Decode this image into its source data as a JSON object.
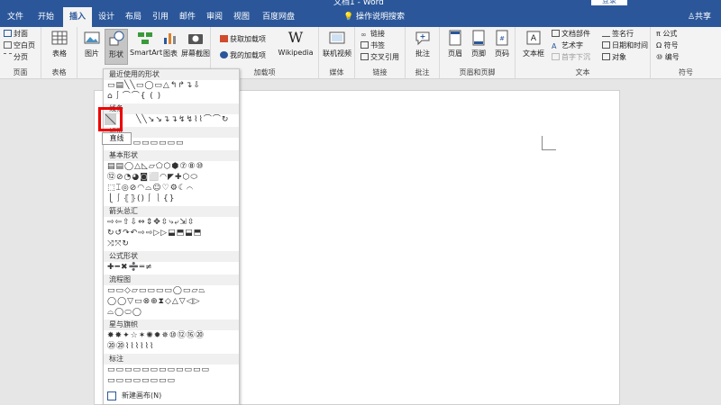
{
  "app": {
    "title": "文档1 - Word",
    "login": "登录",
    "share": "共享",
    "help_search": "操作说明搜索"
  },
  "tabs": [
    "文件",
    "开始",
    "插入",
    "设计",
    "布局",
    "引用",
    "邮件",
    "审阅",
    "视图",
    "百度网盘"
  ],
  "ribbon": {
    "page": {
      "cover": "封面",
      "blank": "空白页",
      "break": "分页",
      "label": "页面"
    },
    "table": {
      "label": "表格",
      "btn": "表格"
    },
    "illust": {
      "picture": "图片",
      "shapes": "形状",
      "smartart": "SmartArt",
      "chart": "图表",
      "screenshot": "屏幕截图"
    },
    "addins": {
      "get": "获取加载项",
      "mine": "我的加载项",
      "wikipedia": "Wikipedia",
      "label": "加载项"
    },
    "media": {
      "video": "联机视频",
      "label": "媒体"
    },
    "links": {
      "link": "链接",
      "bookmark": "书签",
      "crossref": "交叉引用",
      "label": "链接"
    },
    "comments": {
      "comment": "批注",
      "label": "批注"
    },
    "hf": {
      "header": "页眉",
      "footer": "页脚",
      "pagenum": "页码",
      "label": "页眉和页脚"
    },
    "text": {
      "textbox": "文本框",
      "parts": "文档部件",
      "wordart": "艺术字",
      "dropcap": "首字下沉",
      "sigline": "签名行",
      "datetime": "日期和时间",
      "object": "对象",
      "label": "文本"
    },
    "symbols": {
      "equation": "公式",
      "symbol": "符号",
      "number": "编号",
      "label": "符号"
    }
  },
  "gallery": {
    "sections": [
      {
        "title": "最近使用的形状",
        "rows": [
          "▭▤╲╲▭◯▭△↰↱↴⇩",
          "⌂⎰⌒⌒{ ( )"
        ]
      },
      {
        "title": "线条",
        "rows": [
          "╲╲↘↘↴↴↯↯⌇⌇⌒⌒↻"
        ]
      },
      {
        "title": "矩形",
        "rows": [
          "▭▭▭▭▭▭▭▭▭"
        ]
      },
      {
        "title": "基本形状",
        "rows": [
          "▤▤◯△◺▱⬠⬡⬢⑦⑧⑩",
          "⑫⊘◔◕◙⬜◠◤✚⬡⬭",
          "⬚⌶◎⊘◠⌓☺♡⚙☾⌒",
          "⎩⎰⦃⦄()⎰⎱{}"
        ]
      },
      {
        "title": "箭头总汇",
        "rows": [
          "⇨⇦⇧⇩⇔⇕✥⇳⤷⤶⇲⇳",
          "↻↺↷↶⇨⇨▷▷⬓⬒⬓⬒",
          "⤨⤧↻"
        ]
      },
      {
        "title": "公式形状",
        "rows": [
          "✚━✖➗═≠"
        ]
      },
      {
        "title": "流程图",
        "rows": [
          "▭▭◇▱▭▭▭▭◯▭▱⏢",
          "◯◯▽▭⊗⊕⧗◇△▽◁▷",
          "⌓◯⬭◯"
        ]
      },
      {
        "title": "星与旗帜",
        "rows": [
          "✸✸✦☆✶✺✹✵⑩⑫⑯⑳",
          "⑳⑳⌇⌇⌇⌇⌇⌇"
        ]
      },
      {
        "title": "标注",
        "rows": [
          "▭▭▭▭▭▭▭▭▭▭▭▭",
          "▭▭▭▭▭▭▭▭"
        ]
      }
    ],
    "new_canvas": "新建画布(N)",
    "tooltip": "直线"
  }
}
